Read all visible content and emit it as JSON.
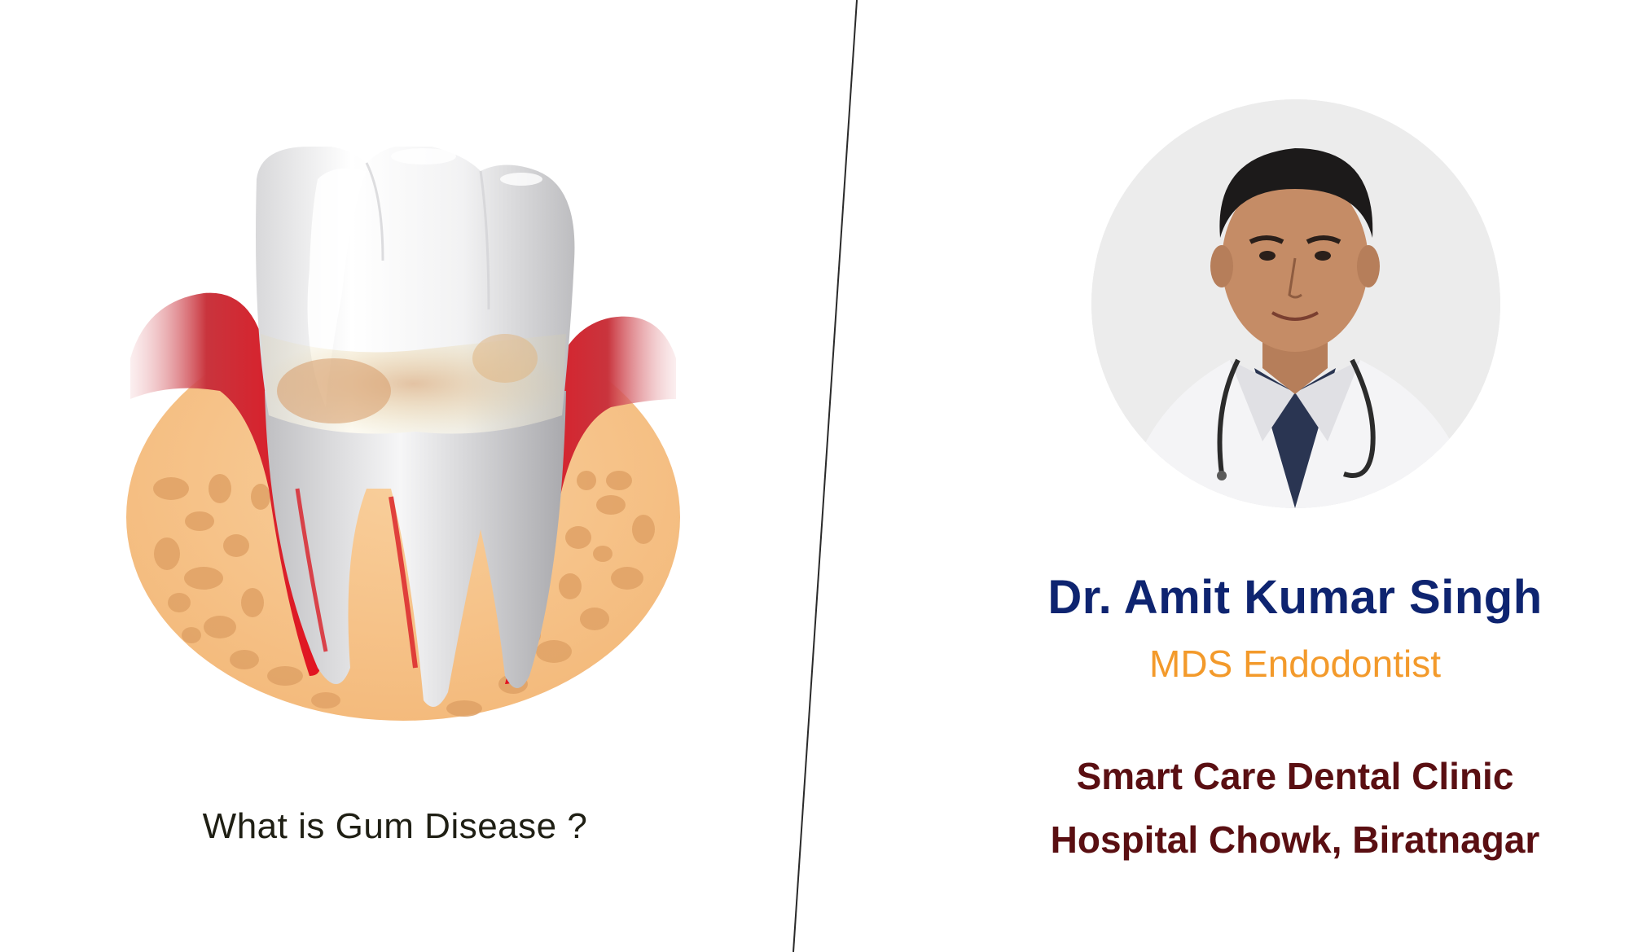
{
  "left": {
    "caption": "What is Gum Disease ?"
  },
  "right": {
    "doctor_name": "Dr. Amit Kumar Singh",
    "qualification": "MDS Endodontist",
    "clinic_name": "Smart Care Dental Clinic",
    "clinic_address": "Hospital Chowk, Biratnagar"
  },
  "colors": {
    "name": "#0e2470",
    "qualification": "#f39a2b",
    "clinic": "#5a0f12",
    "gum": "#d40f1c",
    "bone": "#f7c58d"
  },
  "icons": [
    "tooth-illustration",
    "doctor-portrait"
  ]
}
